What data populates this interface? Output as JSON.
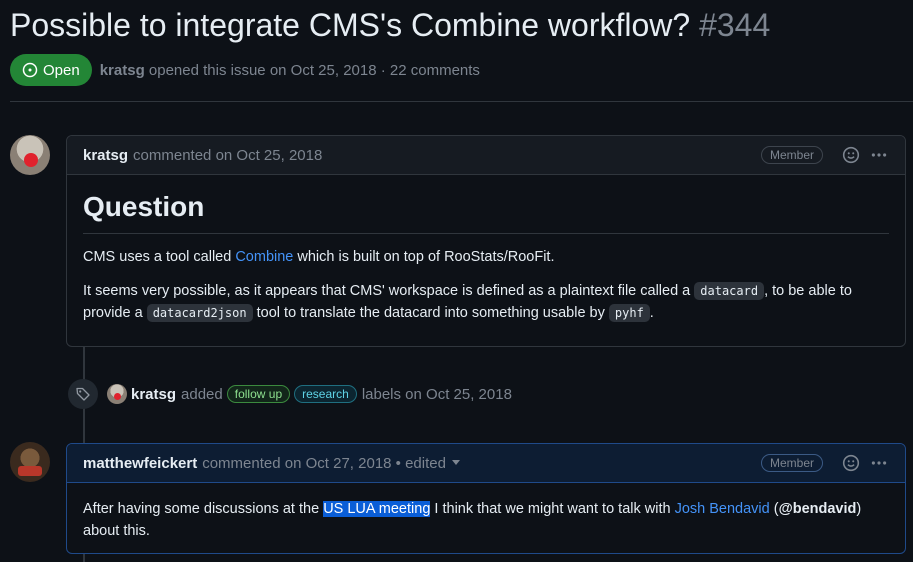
{
  "issue": {
    "title": "Possible to integrate CMS's Combine workflow?",
    "number": "#344",
    "state": "Open",
    "author": "kratsg",
    "meta": "opened this issue on Oct 25, 2018 · 22 comments"
  },
  "comment1": {
    "author": "kratsg",
    "action": "commented on Oct 25, 2018",
    "role": "Member",
    "heading": "Question",
    "p1_before": "CMS uses a tool called ",
    "p1_link": "Combine",
    "p1_after": " which is built on top of RooStats/RooFit.",
    "p2_a": "It seems very possible, as it appears that CMS' workspace is defined as a plaintext file called a ",
    "p2_code1": "datacard",
    "p2_b": ", to be able to provide a ",
    "p2_code2": "datacard2json",
    "p2_c": " tool to translate the datacard into something usable by ",
    "p2_code3": "pyhf",
    "p2_d": "."
  },
  "event": {
    "author": "kratsg",
    "verb": "added",
    "labels": [
      "follow up",
      "research"
    ],
    "after": "labels on Oct 25, 2018"
  },
  "comment2": {
    "author": "matthewfeickert",
    "action": "commented on Oct 27, 2018 • edited",
    "role": "Member",
    "p_a": "After having some discussions at the ",
    "p_highlight": "US LUA meeting",
    "p_b": " I think that we might want to talk with ",
    "p_link": "Josh Bendavid",
    "p_c": " (",
    "p_mention": "@bendavid",
    "p_d": ") about this."
  },
  "icons": [
    "issue-open-icon",
    "smiley-icon",
    "kebab-icon",
    "tag-icon",
    "caret-down-icon"
  ],
  "colors": {
    "open_green": "#238636",
    "link_blue": "#4493f8",
    "highlight": "#0a5ed7"
  }
}
